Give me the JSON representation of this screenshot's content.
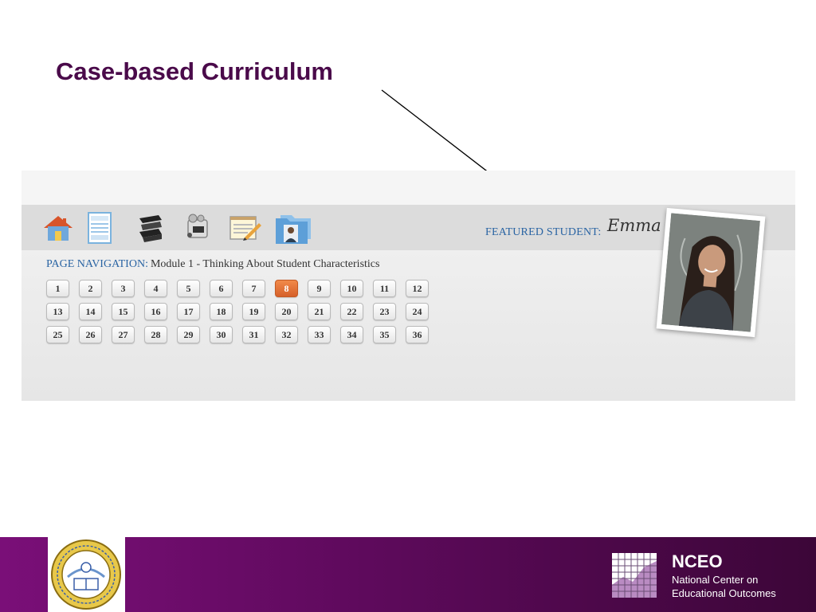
{
  "slide": {
    "title": "Case-based Curriculum"
  },
  "toolbar": {
    "icons": [
      "home-icon",
      "document-icon",
      "books-icon",
      "video-camera-icon",
      "notepad-pencil-icon",
      "student-folder-icon"
    ]
  },
  "featured": {
    "label": "FEATURED STUDENT:",
    "name": "Emma"
  },
  "navigation": {
    "label": "PAGE NAVIGATION:",
    "module": "Module 1 - Thinking About Student Characteristics",
    "current_page": "8",
    "pages": [
      "1",
      "2",
      "3",
      "4",
      "5",
      "6",
      "7",
      "8",
      "9",
      "10",
      "11",
      "12",
      "13",
      "14",
      "15",
      "16",
      "17",
      "18",
      "19",
      "20",
      "21",
      "22",
      "23",
      "24",
      "25",
      "26",
      "27",
      "28",
      "29",
      "30",
      "31",
      "32",
      "33",
      "34",
      "35",
      "36"
    ]
  },
  "footer": {
    "seal_icon": "state-department-of-education-seal",
    "org_short": "NCEO",
    "org_line1": "National Center on",
    "org_line2": "Educational Outcomes"
  },
  "colors": {
    "title": "#4a0a4a",
    "accent_blue": "#2a64a3",
    "active_page": "#e4702f",
    "footer": "#5e0a5c"
  }
}
